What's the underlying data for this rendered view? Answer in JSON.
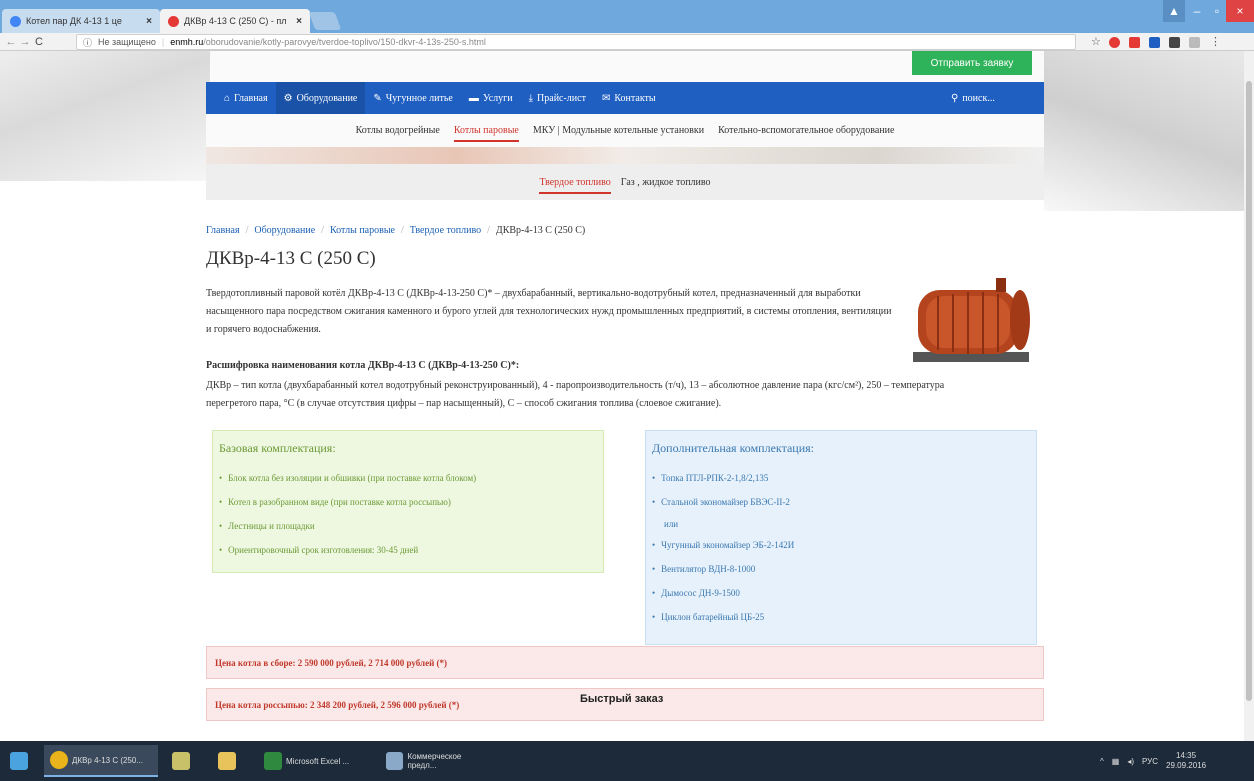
{
  "browser": {
    "tabs": [
      {
        "label": "Котел пар ДК 4-13 1 це",
        "active": false
      },
      {
        "label": "ДКВр 4-13 С (250 С) - пл",
        "active": true
      }
    ],
    "address": {
      "security": "Не защищено",
      "host": "enmh.ru",
      "path": "/oborudovanie/kotly-parovye/tverdoe-toplivo/150-dkvr-4-13s-250-s.html"
    }
  },
  "header": {
    "order_button": "Отправить заявку"
  },
  "mainnav": {
    "items": [
      "Главная",
      "Оборудование",
      "Чугунное литье",
      "Услуги",
      "Прайс-лист",
      "Контакты"
    ],
    "search": "поиск..."
  },
  "subnav": {
    "items": [
      "Котлы водогрейные",
      "Котлы паровые",
      "МКУ | Модульные котельные установки",
      "Котельно-вспомогательное оборудование"
    ]
  },
  "fueltabs": {
    "items": [
      "Твердое топливо",
      "Газ , жидкое топливо"
    ]
  },
  "breadcrumb": {
    "items": [
      "Главная",
      "Оборудование",
      "Котлы паровые",
      "Твердое топливо"
    ],
    "current": "ДКВр-4-13 С (250 С)"
  },
  "product": {
    "title": "ДКВр-4-13 С (250 С)",
    "description": "Твердотопливный паровой котёл ДКВр-4-13 С (ДКВр-4-13-250 С)* – двухбарабанный, вертикально-водотрубный котел, предназначенный для выработки насыщенного пара посредством сжигания каменного и бурого углей для технологических нужд промышленных предприятий, в системы отопления, вентиляции и горячего водоснабжения.",
    "decode_title": "Расшифровка наименования котла ДКВр-4-13 С (ДКВр-4-13-250 С)*:",
    "decode_text": "ДКВр – тип котла (двухбарабанный котел водотрубный реконструированный), 4 - паропроизводительность (т/ч), 13 – абсолютное давление пара (кгс/см²), 250 – температура перегретого пара, °С (в случае отсутствия цифры – пар насыщенный), С – способ сжигания топлива (слоевое сжигание)."
  },
  "base_kit": {
    "title": "Базовая комплектация:",
    "items": [
      "Блок котла без изоляции и обшивки (при поставке котла блоком)",
      "Котел в разобранном виде (при поставке котла россыпью)",
      "Лестницы и площадки",
      "Ориентировочный срок изготовления: 30-45 дней"
    ]
  },
  "extra_kit": {
    "title": "Дополнительная комплектация:",
    "items": [
      "Топка ПТЛ-РПК-2-1,8/2,135",
      "Стальной экономайзер БВЭС-II-2",
      "Чугунный экономайзер ЭБ-2-142И",
      "Вентилятор ВДН-8-1000",
      "Дымосос ДН-9-1500",
      "Циклон батарейный ЦБ-25"
    ],
    "or_label": "или"
  },
  "prices": {
    "assembled": "Цена котла в сборе: 2 590 000 рублей, 2 714 000 рублей (*)",
    "loose": "Цена котла россыпью: 2 348 200 рублей, 2 596 000 рублей (*)"
  },
  "quick_order": "Быстрый заказ",
  "taskbar": {
    "tasks": [
      "ДКВр 4-13 С (250...",
      "Microsoft Excel ...",
      "Коммерческое предл..."
    ],
    "lang": "РУС",
    "time": "14:35",
    "date": "29.09.2016"
  },
  "colors": {
    "nav_blue": "#1f5fc2",
    "accent_red": "#d0342c",
    "green_button": "#2fb35a"
  }
}
